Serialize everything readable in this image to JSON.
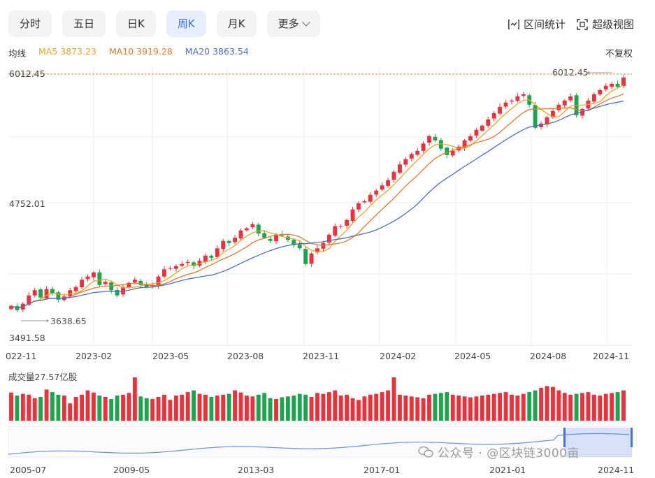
{
  "tabs": [
    {
      "label": "分时",
      "active": false
    },
    {
      "label": "五日",
      "active": false
    },
    {
      "label": "日K",
      "active": false
    },
    {
      "label": "周K",
      "active": true
    },
    {
      "label": "月K",
      "active": false
    },
    {
      "label": "更多",
      "active": false
    }
  ],
  "tools": {
    "range_stats": "区间统计",
    "super_view": "超级视图"
  },
  "legend": {
    "label": "均线",
    "ma5": "MA5 3873.23",
    "ma10": "MA10 3919.28",
    "ma20": "MA20 3863.54"
  },
  "adjust_label": "不复权",
  "colors": {
    "up": "#e8333d",
    "down": "#1ea34f",
    "ma5": "#e8a425",
    "ma10": "#e4782f",
    "ma20": "#4c6fc0",
    "accent": "#3a6fd8"
  },
  "chart_data": {
    "type": "candlestick",
    "price_axis_labels": [
      "6012.45",
      "4752.01",
      "3491.58"
    ],
    "ylim": [
      3491.58,
      6012.45
    ],
    "max_marker": "6012.45",
    "min_marker": "3638.65",
    "x_tick_labels": [
      "022-11",
      "2023-02",
      "2023-05",
      "2023-08",
      "2023-11",
      "2024-02",
      "2024-05",
      "2024-08",
      "2024-11"
    ],
    "weekly_close": [
      3800,
      3760,
      3820,
      3900,
      3950,
      3880,
      3960,
      3920,
      3860,
      3890,
      3950,
      3980,
      4050,
      4080,
      4120,
      4000,
      4030,
      3950,
      3900,
      3980,
      4020,
      4050,
      4000,
      3980,
      4000,
      4080,
      4150,
      4160,
      4180,
      4200,
      4220,
      4180,
      4230,
      4280,
      4260,
      4350,
      4420,
      4400,
      4450,
      4520,
      4540,
      4580,
      4490,
      4450,
      4420,
      4480,
      4470,
      4430,
      4380,
      4350,
      4200,
      4300,
      4350,
      4400,
      4480,
      4560,
      4560,
      4620,
      4720,
      4780,
      4800,
      4860,
      4900,
      4950,
      5000,
      5080,
      5150,
      5200,
      5250,
      5280,
      5350,
      5420,
      5380,
      5300,
      5240,
      5280,
      5320,
      5380,
      5420,
      5480,
      5520,
      5580,
      5640,
      5700,
      5740,
      5760,
      5800,
      5820,
      5720,
      5500,
      5540,
      5600,
      5660,
      5720,
      5760,
      5800,
      5620,
      5680,
      5760,
      5820,
      5860,
      5900,
      5920,
      5890,
      5980
    ],
    "volume_label": "成交量27.57亿股",
    "volume": [
      65,
      58,
      62,
      60,
      52,
      55,
      72,
      66,
      60,
      58,
      40,
      55,
      60,
      70,
      65,
      58,
      55,
      50,
      58,
      60,
      64,
      100,
      56,
      52,
      50,
      55,
      60,
      48,
      58,
      60,
      66,
      70,
      62,
      60,
      55,
      58,
      60,
      62,
      70,
      65,
      58,
      56,
      60,
      64,
      52,
      50,
      54,
      56,
      58,
      62,
      60,
      55,
      64,
      62,
      66,
      70,
      58,
      60,
      52,
      48,
      56,
      60,
      62,
      66,
      70,
      100,
      60,
      58,
      56,
      54,
      52,
      60,
      62,
      64,
      66,
      60,
      58,
      56,
      54,
      56,
      58,
      60,
      62,
      64,
      66,
      60,
      58,
      62,
      66,
      70,
      76,
      80,
      78,
      70,
      64,
      60,
      62,
      64,
      66,
      60,
      58,
      62,
      64,
      66,
      70
    ],
    "overview_x_labels": [
      "2005-07",
      "2009-05",
      "2013-03",
      "2017-01",
      "2021-01",
      "2024-11"
    ]
  },
  "watermark": "公众号 · @区块链3000亩"
}
